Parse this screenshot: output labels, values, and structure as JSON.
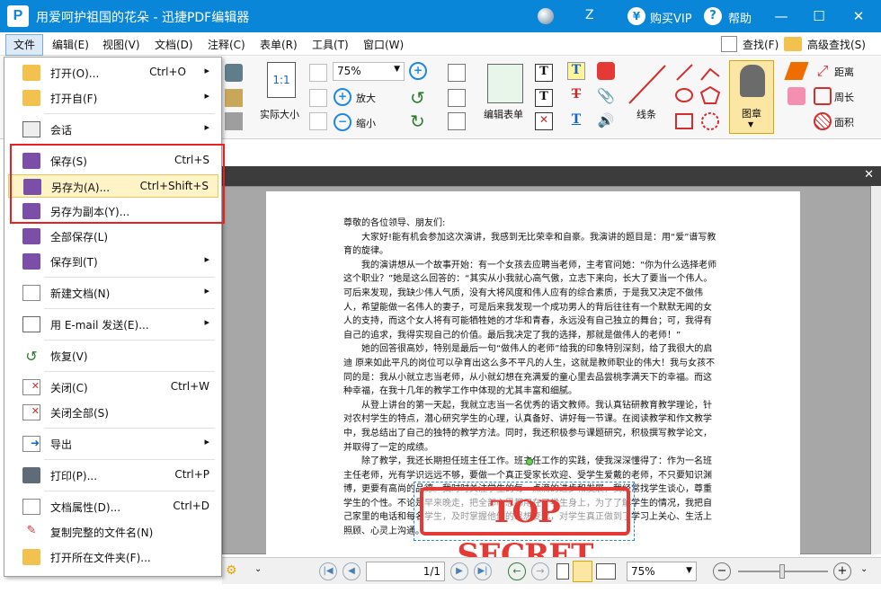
{
  "window": {
    "title": "用爱呵护祖国的花朵 - 迅捷PDF编辑器",
    "z_label": "Z",
    "vip_label": "购买VIP",
    "help_label": "帮助"
  },
  "menubar": {
    "items": [
      "文件",
      "编辑(E)",
      "视图(V)",
      "文档(D)",
      "注释(C)",
      "表单(R)",
      "工具(T)",
      "窗口(W)"
    ],
    "find": "查找(F)",
    "adv_find": "高级查找(S)"
  },
  "toolbar": {
    "actual_size": "实际大小",
    "zoom": "75%",
    "zoom_in": "放大",
    "zoom_out": "缩小",
    "edit_form": "编辑表单",
    "line": "线条",
    "stamp": "图章",
    "distance": "距离",
    "perimeter": "周长",
    "area": "面积"
  },
  "file_menu": [
    {
      "label": "打开(O)...",
      "shortcut": "Ctrl+O",
      "arrow": true,
      "icon": "open-folder-icon"
    },
    {
      "label": "打开自(F)",
      "shortcut": "",
      "arrow": true,
      "icon": "open-from-icon"
    },
    {
      "label": "会话",
      "shortcut": "",
      "arrow": true,
      "icon": "session-icon"
    },
    {
      "label": "保存(S)",
      "shortcut": "Ctrl+S",
      "arrow": false,
      "icon": "save-icon"
    },
    {
      "label": "另存为(A)...",
      "shortcut": "Ctrl+Shift+S",
      "arrow": false,
      "icon": "save-as-icon"
    },
    {
      "label": "另存为副本(Y)...",
      "shortcut": "",
      "arrow": false,
      "icon": "save-copy-icon"
    },
    {
      "label": "全部保存(L)",
      "shortcut": "",
      "arrow": false,
      "icon": "save-all-icon"
    },
    {
      "label": "保存到(T)",
      "shortcut": "",
      "arrow": true,
      "icon": "save-to-icon"
    },
    {
      "label": "新建文档(N)",
      "shortcut": "",
      "arrow": true,
      "icon": "new-document-icon"
    },
    {
      "label": "用 E-mail 发送(E)...",
      "shortcut": "",
      "arrow": true,
      "icon": "email-icon"
    },
    {
      "label": "恢复(V)",
      "shortcut": "",
      "arrow": false,
      "icon": "revert-icon"
    },
    {
      "label": "关闭(C)",
      "shortcut": "Ctrl+W",
      "arrow": false,
      "icon": "close-doc-icon"
    },
    {
      "label": "关闭全部(S)",
      "shortcut": "",
      "arrow": false,
      "icon": "close-all-icon"
    },
    {
      "label": "导出",
      "shortcut": "",
      "arrow": true,
      "icon": "export-icon"
    },
    {
      "label": "打印(P)...",
      "shortcut": "Ctrl+P",
      "arrow": false,
      "icon": "print-icon"
    },
    {
      "label": "文档属性(D)...",
      "shortcut": "Ctrl+D",
      "arrow": false,
      "icon": "properties-icon"
    },
    {
      "label": "复制完整的文件名(N)",
      "shortcut": "",
      "arrow": false,
      "icon": "copy-filename-icon"
    },
    {
      "label": "打开所在文件夹(F)...",
      "shortcut": "",
      "arrow": false,
      "icon": "open-folder-location-icon"
    }
  ],
  "document": {
    "paragraphs": [
      "尊敬的各位领导、朋友们:",
      "大家好!能有机会参加这次演讲，我感到无比荣幸和自豪。我演讲的题目是：用“爱”谱写教育的旋律。",
      "我的演讲想从一个故事开始：有一个女孩去应聘当老师，主考官问她：“你为什么选择老师这个职业？”她是这么回答的：“其实从小我就心高气傲，立志下来向，长大了要当一个伟人。可后来发现，我缺少伟人气质，没有大将风度和伟人应有的综合素质，于是我又决定不做伟人，希望能做一名伟人的妻子，可是后来我发现一个成功男人的背后往往有一个默默无闻的女人的支持，而这个女人将有可能牺牲她的才华和青春，永远没有自己独立的舞台；可，我得有自己的追求，我得实现自己的价值。最后我决定了我的选择，那就是做伟人的老师！”",
      "她的回答很高妙，特别是最后一句“做伟人的老师”给我的印象特别深刻，给了我很大的启迪 原来如此平凡的岗位可以孕育出这么多不平凡的人生，这就是教师职业的伟大！我与女孩不同的是：我从小就立志当老师，从小就幻想在充满爱的童心里去品尝桃李满天下的幸福。而这种幸福，在我十几年的教学工作中体现的尤其丰富和细腻。",
      "从登上讲台的第一天起，我就立志当一名优秀的语文教师。我认真钻研教育教学理论，针对农村学生的特点，潜心研究学生的心理，认真备好、讲好每一节课。在阅读教学和作文教学中，我总结出了自己的独特的教学方法。同时，我还积极参与课题研究，积极撰写教学论文，并取得了一定的成绩。",
      "除了教学，我还长期担任班主任工作。班主任工作的实践，使我深深懂得了：作为一名班主任老师，光有学识远远不够，要做一个真正受家长欢迎、受学生爱戴的老师，不只要知识渊博，更要有高尚的品德。我时时关注学生的每一点滴的进步和发展，我经常找学生谈心，尊重学生的个性。不论是早来晚走，把全部心思都用在了学生身上，为了了解学生的情况，我把自己家里的电话和每名学生，及时掌握他们的思想变化，对学生真正做到了学习上关心、生活上照顾、心灵上沟通。"
    ],
    "stamp": "TOP SECRET"
  },
  "statusbar": {
    "page": "1/1",
    "zoom": "75%"
  }
}
